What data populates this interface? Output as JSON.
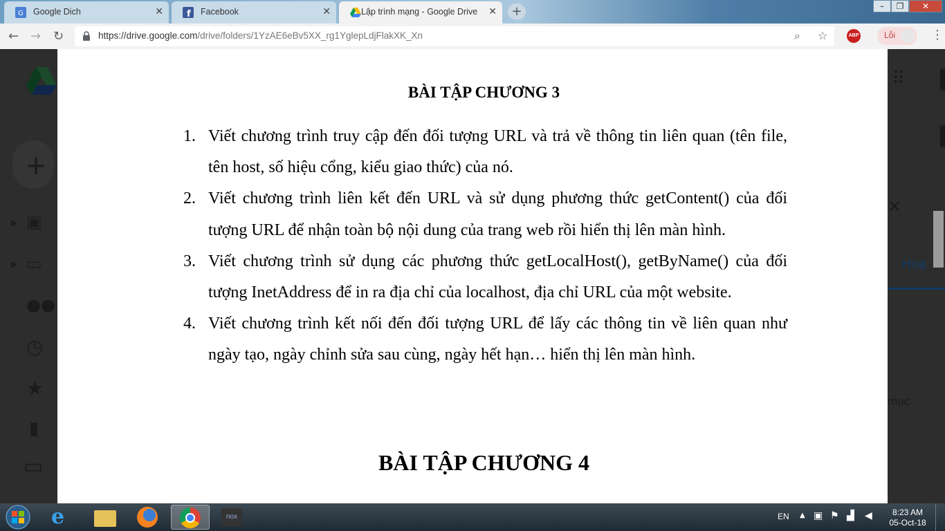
{
  "browser": {
    "tabs": [
      {
        "title": "Google Dich",
        "icon": "google-translate-icon",
        "active": false
      },
      {
        "title": "Facebook",
        "icon": "facebook-icon",
        "active": false
      },
      {
        "title": "Lập trình mạng - Google Drive",
        "icon": "google-drive-icon",
        "active": true
      }
    ],
    "url_host": "https://drive.google.com",
    "url_path": "/drive/folders/1YzAE6eBv5XX_rg1YglepLdjFlakXK_Xn",
    "profile_label": "Lỗi",
    "abp_label": "ABP"
  },
  "background": {
    "right_link": "Hoạ",
    "right_text": "mục"
  },
  "document": {
    "heading1": "BÀI TẬP CHƯƠNG 3",
    "exercises": [
      {
        "num": "1.",
        "text": "Viết chương trình truy cập đến đối tượng URL và trả về thông tin liên quan (tên file, tên host, số hiệu cổng, kiểu giao thức) của nó."
      },
      {
        "num": "2.",
        "text": "Viết chương trình liên kết đến URL và sử dụng phương thức getContent() của đối tượng URL để nhận toàn bộ nội dung của trang web rồi hiển thị lên màn hình."
      },
      {
        "num": "3.",
        "text": "Viết chương trình sử dụng các phương thức getLocalHost(), getByName() của đối tượng InetAddress để in ra địa chỉ của localhost, địa chỉ URL của một website."
      },
      {
        "num": "4.",
        "text": "Viết chương trình kết nối đến đối tượng URL để lấy các thông tin về liên quan như ngày tạo, ngày chỉnh sửa sau cùng, ngày hết hạn… hiển thị lên màn hình."
      }
    ],
    "heading2": "BÀI TẬP CHƯƠNG 4"
  },
  "taskbar": {
    "language": "EN",
    "time": "8:23 AM",
    "date": "05-Oct-18"
  },
  "colors": {
    "abp_red": "#c8201f",
    "drive_blue": "#1a73e8"
  }
}
